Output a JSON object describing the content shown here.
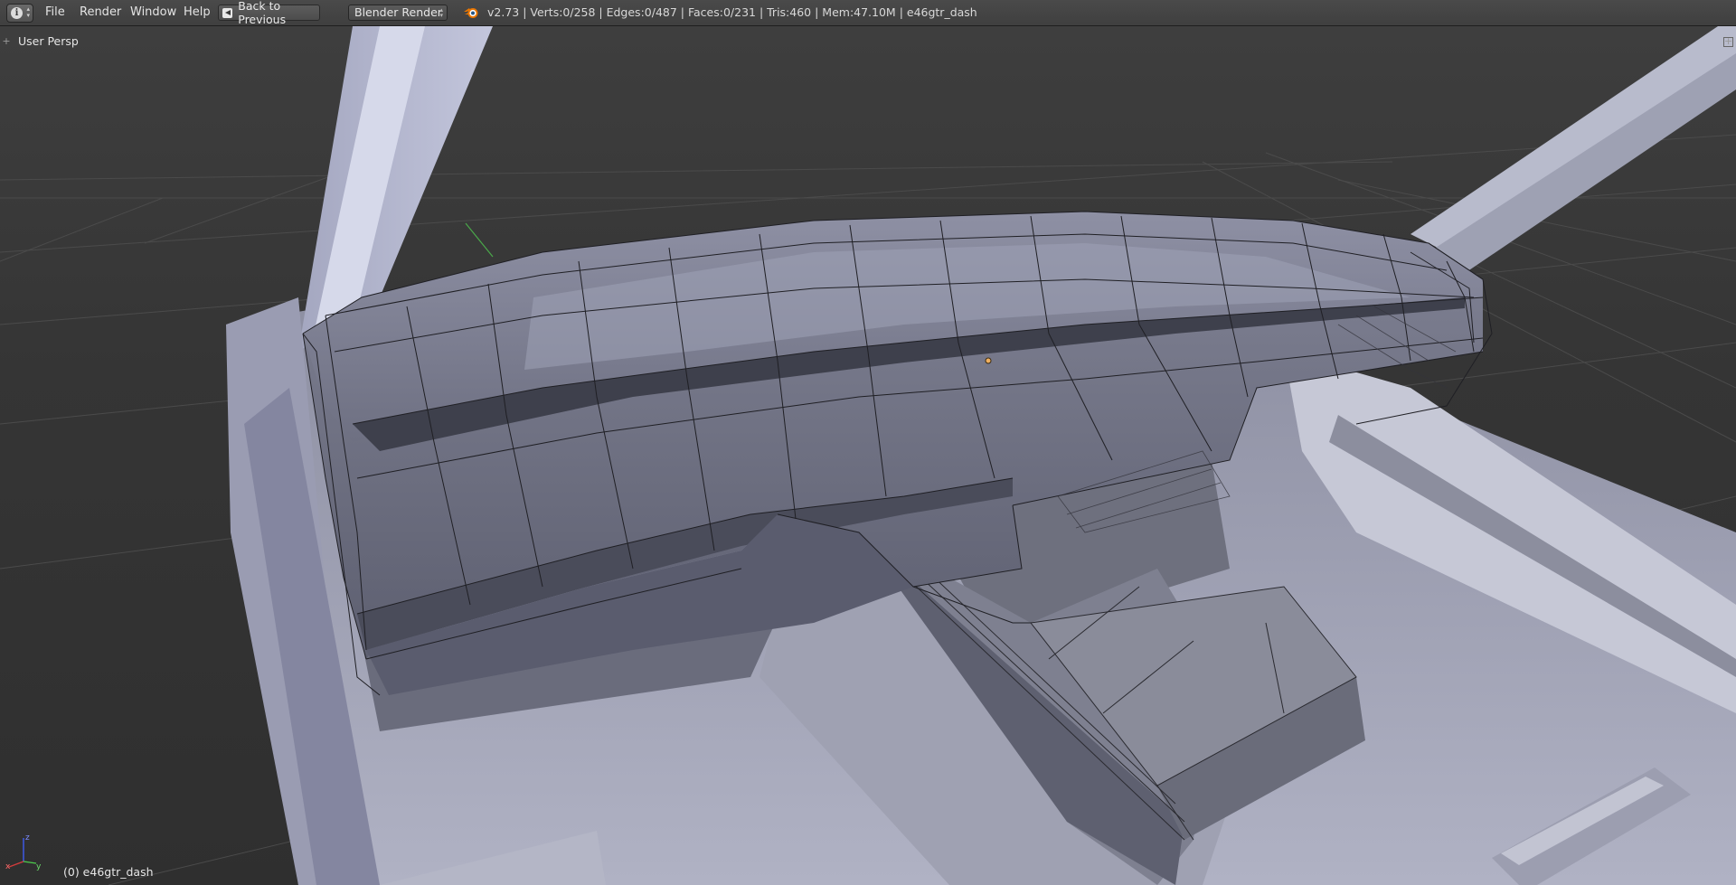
{
  "header": {
    "editor_type_icon": "info-icon",
    "menus": [
      "File",
      "Render",
      "Window",
      "Help"
    ],
    "back_button": "Back to Previous",
    "render_engine": "Blender Render",
    "stats": "v2.73 | Verts:0/258 | Edges:0/487 | Faces:0/231 | Tris:460 | Mem:47.10M | e46gtr_dash"
  },
  "viewport": {
    "view_label": "User Persp",
    "object_label": "(0) e46gtr_dash",
    "gizmo_axes": [
      "x",
      "y",
      "z"
    ]
  },
  "colors": {
    "header_bg": "#444444",
    "viewport_bg": "#393939",
    "grid_line": "#4a4a4a",
    "mesh_fill": "#7d8093",
    "mesh_shadow": "#4f5161",
    "body_fill": "#a9abbd",
    "x_axis": "#d43c3c",
    "y_axis": "#4ccc4c",
    "z_axis": "#3c64ff"
  }
}
